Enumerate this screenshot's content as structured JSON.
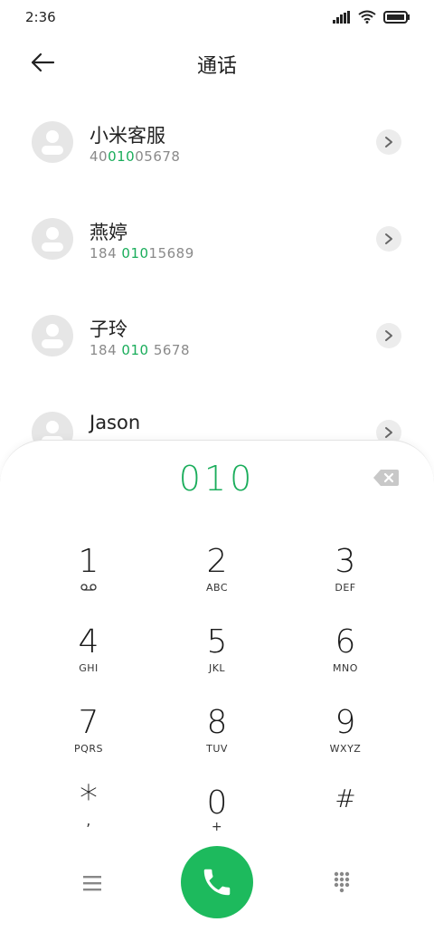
{
  "status_bar": {
    "time": "2:36"
  },
  "header": {
    "title": "通话"
  },
  "contacts": [
    {
      "name": "小米客服",
      "number_pre": "40",
      "number_match": "010",
      "number_post": "05678"
    },
    {
      "name": "燕婷",
      "number_pre": "184 ",
      "number_match": "010",
      "number_post": "15689"
    },
    {
      "name": "子玲",
      "number_pre": "184 ",
      "number_match": "010",
      "number_post": " 5678"
    },
    {
      "name": "Jason",
      "number_pre": "",
      "number_match": "",
      "number_post": ""
    }
  ],
  "dialer": {
    "dialed_number": "010",
    "keys": [
      {
        "digit": "1",
        "letters": ""
      },
      {
        "digit": "2",
        "letters": "ABC"
      },
      {
        "digit": "3",
        "letters": "DEF"
      },
      {
        "digit": "4",
        "letters": "GHI"
      },
      {
        "digit": "5",
        "letters": "JKL"
      },
      {
        "digit": "6",
        "letters": "MNO"
      },
      {
        "digit": "7",
        "letters": "PQRS"
      },
      {
        "digit": "8",
        "letters": "TUV"
      },
      {
        "digit": "9",
        "letters": "WXYZ"
      },
      {
        "digit": "*",
        "letters": ","
      },
      {
        "digit": "0",
        "letters": "+"
      },
      {
        "digit": "#",
        "letters": ""
      }
    ]
  },
  "colors": {
    "accent": "#1aad5b",
    "call_button": "#1dba5d"
  },
  "icons": {
    "back": "arrow-left-icon",
    "chevron": "chevron-right-icon",
    "delete": "backspace-icon",
    "voicemail": "voicemail-icon",
    "menu": "menu-icon",
    "call": "phone-icon",
    "dialpad": "dialpad-icon"
  }
}
